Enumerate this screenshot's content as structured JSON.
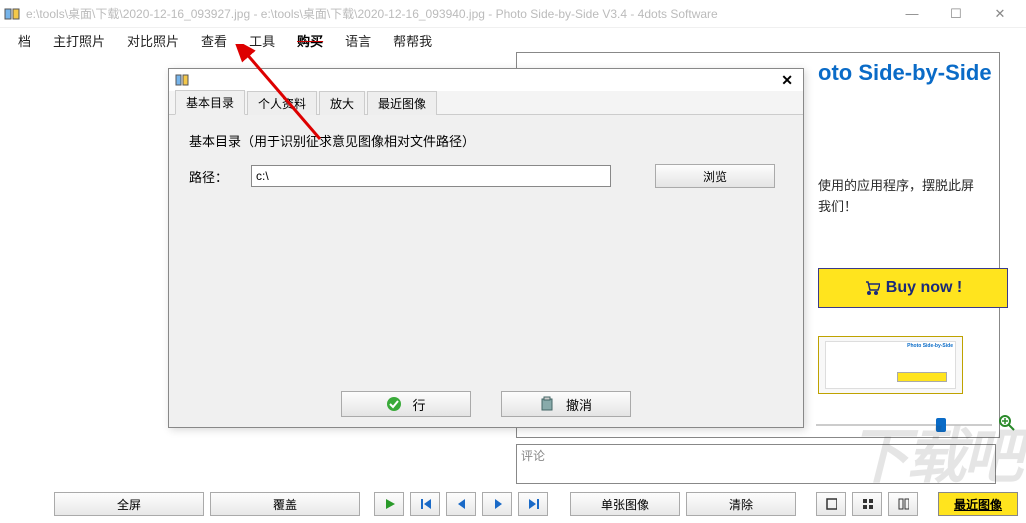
{
  "titlebar": {
    "text": "e:\\tools\\桌面\\下载\\2020-12-16_093927.jpg - e:\\tools\\桌面\\下载\\2020-12-16_093940.jpg - Photo Side-by-Side V3.4 - 4dots Software"
  },
  "menu": {
    "file": "档",
    "main_photo": "主打照片",
    "compare_photo": "对比照片",
    "view": "查看",
    "tools": "工具",
    "buy": "购买",
    "language": "语言",
    "help": "帮帮我"
  },
  "right": {
    "brand": "oto Side-by-Side",
    "promo1": "使用的应用程序，摆脱此屏",
    "promo2": "我们！",
    "buy_now": "Buy now !",
    "thumb_title": "Photo Side-by-Side"
  },
  "comment": {
    "placeholder": "评论"
  },
  "bottom": {
    "fullscreen": "全屏",
    "cover": "覆盖",
    "single_image": "单张图像",
    "clear": "清除",
    "recent": "最近图像"
  },
  "dialog": {
    "tabs": {
      "basic": "基本目录",
      "profile": "个人资料",
      "zoom": "放大",
      "recent": "最近图像"
    },
    "heading": "基本目录（用于识别征求意见图像相对文件路径）",
    "path_label": "路径：",
    "path_value": "c:\\",
    "browse": "浏览",
    "ok": "行",
    "cancel": "撤消"
  },
  "watermark": "下载吧"
}
